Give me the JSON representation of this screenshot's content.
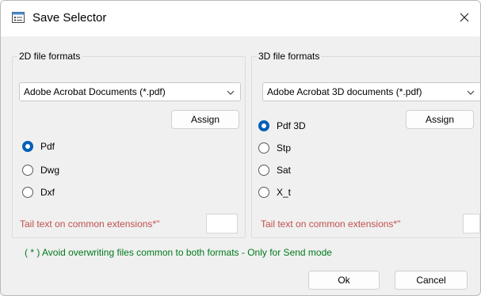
{
  "window": {
    "title": "Save Selector",
    "title_icon": "dialog-list-icon",
    "close_glyph": "✕"
  },
  "left_group": {
    "legend": "2D file formats",
    "combo_value": "Adobe Acrobat Documents (*.pdf)",
    "assign_label": "Assign",
    "radios": [
      {
        "label": "Pdf",
        "checked": true
      },
      {
        "label": "Dwg",
        "checked": false
      },
      {
        "label": "Dxf",
        "checked": false
      }
    ],
    "tail_label": "Tail text on common extensions*\"",
    "tail_value": ""
  },
  "right_group": {
    "legend": "3D file formats",
    "combo_value": "Adobe Acrobat 3D documents (*.pdf)",
    "assign_label": "Assign",
    "radios": [
      {
        "label": "Pdf 3D",
        "checked": true
      },
      {
        "label": "Stp",
        "checked": false
      },
      {
        "label": "Sat",
        "checked": false
      },
      {
        "label": "X_t",
        "checked": false
      }
    ],
    "tail_label": "Tail text on common extensions*\"",
    "tail_value": ""
  },
  "note": "( * ) Avoid overwriting files common to both formats - Only for Send mode",
  "buttons": {
    "ok": "Ok",
    "cancel": "Cancel"
  },
  "colors": {
    "accent": "#005fb8",
    "tail_text": "#c0504d",
    "note_text": "#007a1c"
  }
}
